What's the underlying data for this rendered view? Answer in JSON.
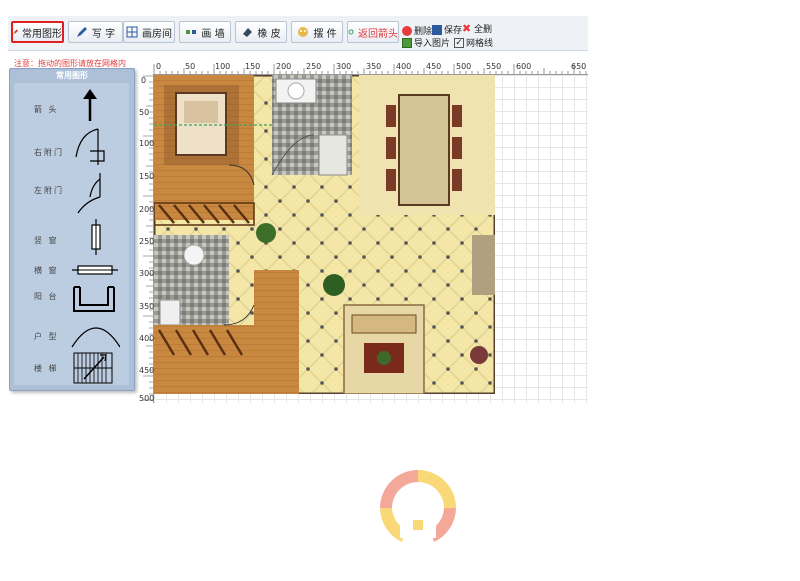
{
  "toolbar": {
    "buttons": [
      {
        "id": "common-shapes",
        "label": "常用图形"
      },
      {
        "id": "write",
        "label": "写 字"
      },
      {
        "id": "draw-room",
        "label": "画房间"
      },
      {
        "id": "draw-wall",
        "label": "画 墙"
      },
      {
        "id": "eraser",
        "label": "橡 皮"
      },
      {
        "id": "furniture",
        "label": "摆 件"
      },
      {
        "id": "return-arrow",
        "label": "返回箭头"
      }
    ],
    "actions": {
      "delete": "删除",
      "save": "保存",
      "delete_all": "全删",
      "import_image": "导入图片",
      "grid_lines": "网格线"
    }
  },
  "notice": "注意：拖动的图形请放在网格内",
  "panel": {
    "title": "常用图形",
    "items": [
      {
        "label": "箭 头",
        "icon": "arrow-up-icon"
      },
      {
        "label": "右附门",
        "icon": "right-door-icon"
      },
      {
        "label": "左附门",
        "icon": "left-door-icon"
      },
      {
        "label": "竖 窗",
        "icon": "vertical-window-icon"
      },
      {
        "label": "横 窗",
        "icon": "horizontal-window-icon"
      },
      {
        "label": "阳 台",
        "icon": "balcony-icon"
      },
      {
        "label": "户 型",
        "icon": "arc-icon"
      },
      {
        "label": "楼 梯",
        "icon": "stairs-icon"
      }
    ]
  },
  "ruler": {
    "top": [
      "0",
      "50",
      "100",
      "150",
      "200",
      "250",
      "300",
      "350",
      "400",
      "450",
      "500",
      "550",
      "600",
      "650"
    ],
    "left": [
      "0",
      "50",
      "100",
      "150",
      "200",
      "250",
      "300",
      "350",
      "400",
      "450",
      "500"
    ]
  },
  "colors": {
    "active_border": "#e01f1f",
    "panel_bg": "#adc0d8",
    "floor_wood": "#c98840",
    "floor_tile": "#f3e6a6"
  }
}
